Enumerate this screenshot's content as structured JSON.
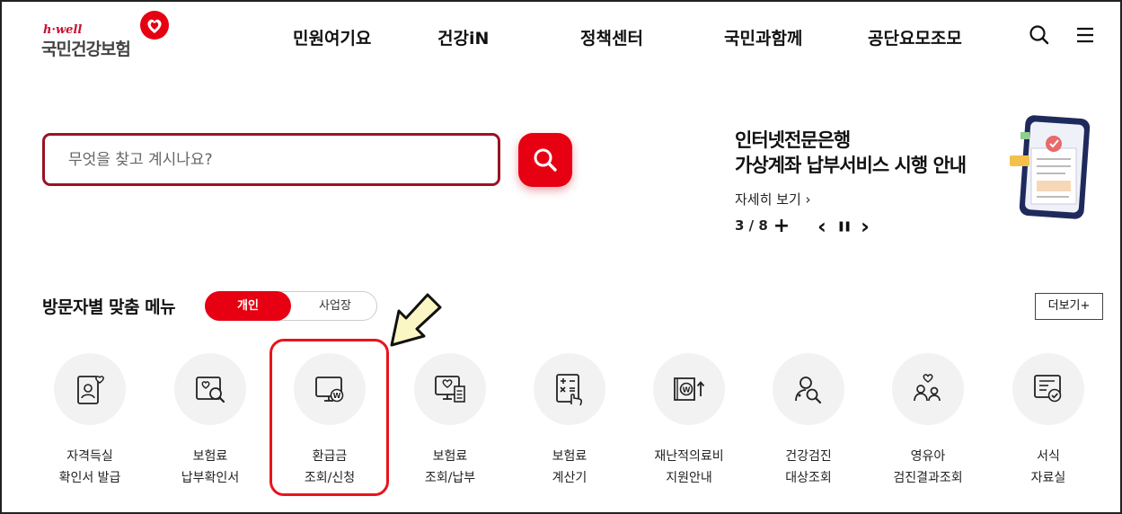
{
  "header": {
    "logo_sub": "h·well",
    "logo_main": "국민건강보험",
    "nav": [
      "민원여기요",
      "건강iN",
      "정책센터",
      "국민과함께",
      "공단요모조모"
    ],
    "search_icon": "search-icon",
    "menu_icon": "hamburger-menu-icon"
  },
  "search": {
    "placeholder": "무엇을 찾고 계시나요?",
    "value": ""
  },
  "promo": {
    "title_line1": "인터넷전문은행",
    "title_line2": "가상계좌 납부서비스 시행 안내",
    "link": "자세히 보기 ›",
    "counter": "3 / 8",
    "plus": "+",
    "prev": "‹",
    "pause": "❚❚",
    "next": "›"
  },
  "section": {
    "title": "방문자별 맞춤 메뉴",
    "toggle_active": "개인",
    "toggle_inactive": "사업장",
    "more": "더보기+"
  },
  "menu": [
    {
      "line1": "자격득실",
      "line2": "확인서 발급",
      "icon": "id-card-heart-icon"
    },
    {
      "line1": "보험료",
      "line2": "납부확인서",
      "icon": "document-search-icon"
    },
    {
      "line1": "환급금",
      "line2": "조회/신청",
      "icon": "monitor-won-icon"
    },
    {
      "line1": "보험료",
      "line2": "조회/납부",
      "icon": "monitor-receipt-icon"
    },
    {
      "line1": "보험료",
      "line2": "계산기",
      "icon": "calculator-hand-icon"
    },
    {
      "line1": "재난적의료비",
      "line2": "지원안내",
      "icon": "won-support-icon"
    },
    {
      "line1": "건강검진",
      "line2": "대상조회",
      "icon": "person-search-icon"
    },
    {
      "line1": "영유아",
      "line2": "검진결과조회",
      "icon": "family-heart-icon"
    },
    {
      "line1": "서식",
      "line2": "자료실",
      "icon": "form-check-icon"
    }
  ],
  "colors": {
    "brand_red": "#e60012",
    "search_border": "#9a1324",
    "highlight": "#e8141c"
  }
}
